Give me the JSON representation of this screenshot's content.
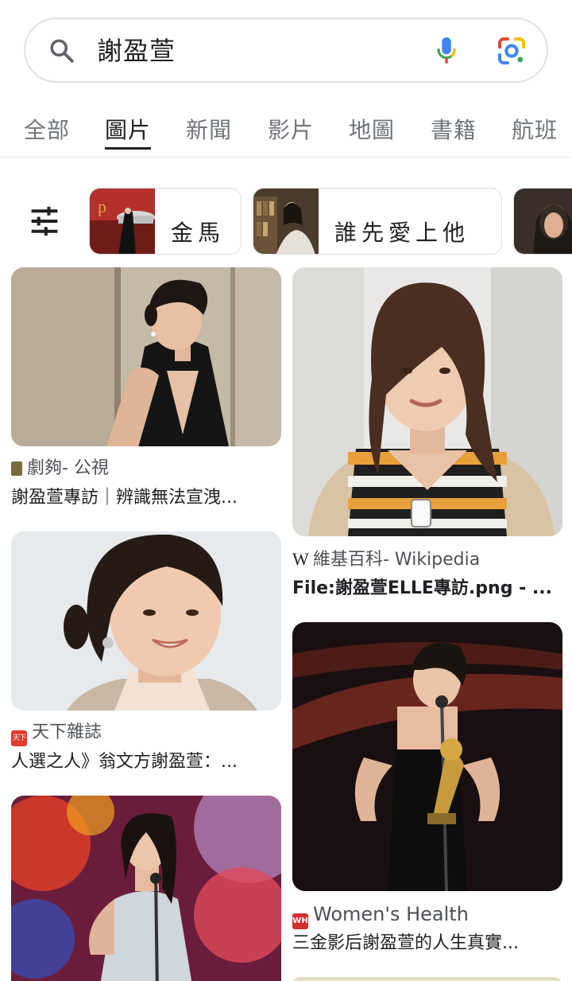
{
  "search": {
    "query": "謝盈萱"
  },
  "tabs": [
    {
      "label": "全部"
    },
    {
      "label": "圖片"
    },
    {
      "label": "新聞"
    },
    {
      "label": "影片"
    },
    {
      "label": "地圖"
    },
    {
      "label": "書籍"
    },
    {
      "label": "航班"
    }
  ],
  "chips": [
    {
      "label": "金馬"
    },
    {
      "label": "誰先愛上他"
    }
  ],
  "results": [
    {
      "source": "劇夠- 公視",
      "title": "謝盈萱專訪｜辨識無法宣洩..."
    },
    {
      "source": "維基百科- Wikipedia",
      "title": "File:謝盈萱ELLE專訪.png - ..."
    },
    {
      "source": "天下雜誌",
      "title": "人選之人》翁文方謝盈萱：..."
    },
    {
      "source": "Women's Health",
      "title": "三金影后謝盈萱的人生真實..."
    }
  ],
  "favicons": {
    "tianxia": "天下",
    "wikipedia": "W",
    "womens_health": "WH"
  },
  "colors": {
    "google_blue": "#4285f4",
    "google_red": "#ea4335",
    "google_yellow": "#fbbc04",
    "google_green": "#34a853"
  }
}
